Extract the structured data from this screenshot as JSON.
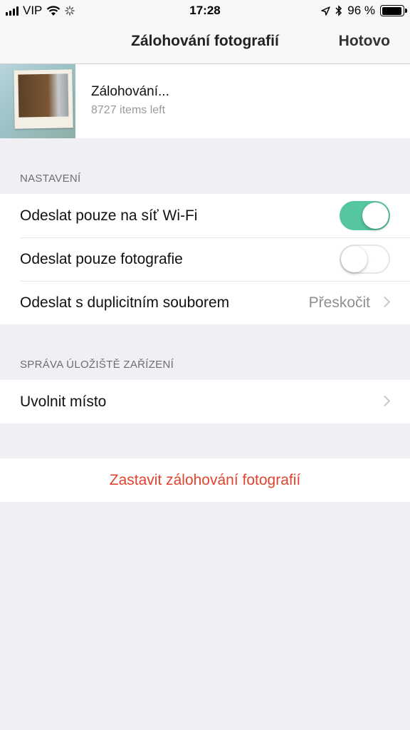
{
  "status_bar": {
    "carrier": "VIP",
    "time": "17:28",
    "battery_percent": "96 %",
    "battery_level": 0.96
  },
  "nav": {
    "title": "Zálohování fotografií",
    "done_label": "Hotovo"
  },
  "backup": {
    "title": "Zálohování...",
    "subtitle": "8727 items left"
  },
  "settings_section": {
    "header": "NASTAVENÍ",
    "rows": [
      {
        "label": "Odeslat pouze na síť Wi-Fi",
        "toggle": true
      },
      {
        "label": "Odeslat pouze fotografie",
        "toggle": false
      },
      {
        "label": "Odeslat s duplicitním souborem",
        "value": "Přeskočit"
      }
    ]
  },
  "storage_section": {
    "header": "SPRÁVA ÚLOŽIŠTĚ ZAŘÍZENÍ",
    "rows": [
      {
        "label": "Uvolnit místo"
      }
    ]
  },
  "stop_button": {
    "label": "Zastavit zálohování fotografií",
    "color": "#e0432f"
  },
  "colors": {
    "toggle_on": "#56c6a1",
    "background": "#efeff4"
  }
}
